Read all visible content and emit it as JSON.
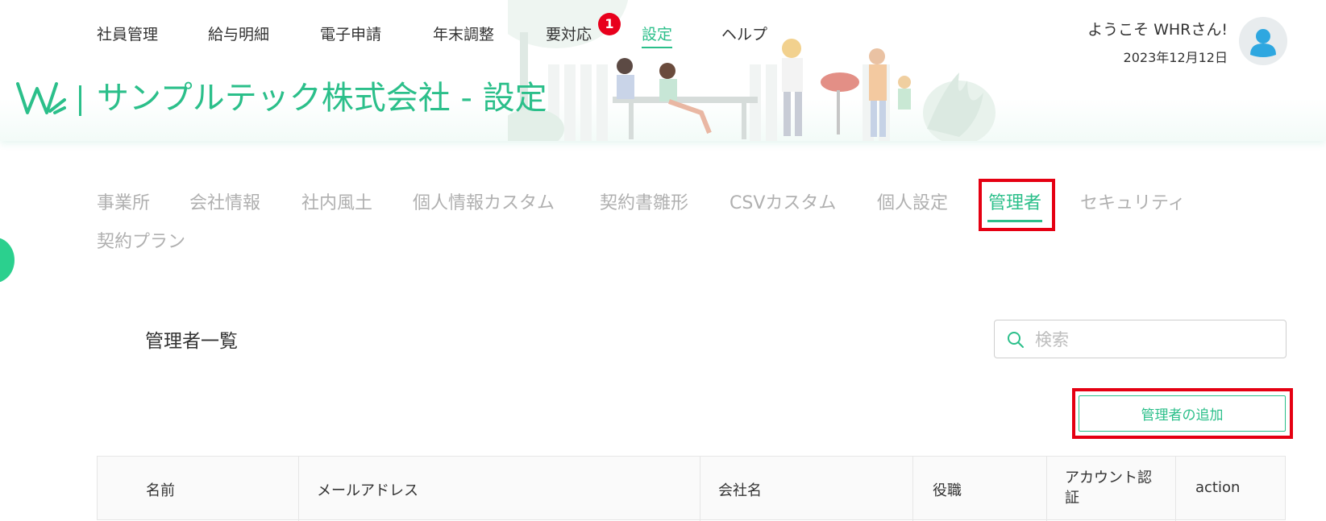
{
  "topnav": {
    "items": [
      "社員管理",
      "給与明細",
      "電子申請",
      "年末調整",
      "要対応",
      "設定",
      "ヘルプ"
    ],
    "active_index": 5,
    "notification_count": "1"
  },
  "user": {
    "welcome": "ようこそ WHRさん!",
    "date": "2023年12月12日"
  },
  "company": {
    "title": "サンプルテック株式会社 - 設定"
  },
  "settings_tabs": {
    "items": [
      "事業所",
      "会社情報",
      "社内風土",
      "個人情報カスタム",
      "契約書雛形",
      "CSVカスタム",
      "個人設定",
      "管理者",
      "セキュリティ",
      "契約プラン"
    ],
    "active_index": 7
  },
  "admin_list": {
    "title": "管理者一覧",
    "search_placeholder": "検索",
    "add_button_label": "管理者の追加",
    "columns": [
      "名前",
      "メールアドレス",
      "会社名",
      "役職",
      "アカウント認証",
      "action"
    ]
  },
  "colors": {
    "accent": "#2bbf8a",
    "badge": "#e8001c",
    "highlight": "#e50012"
  }
}
